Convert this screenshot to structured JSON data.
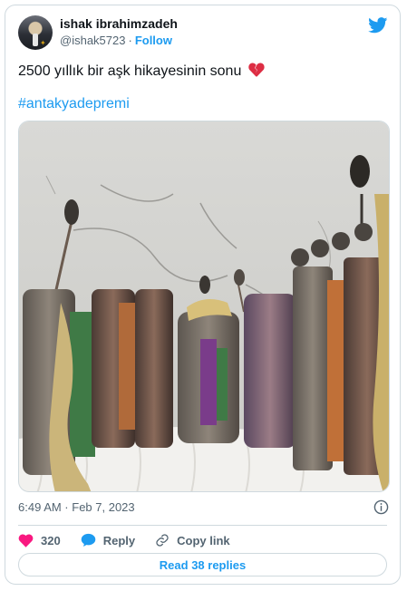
{
  "author": {
    "name": "ishak ibrahimzadeh",
    "handle": "@ishak5723",
    "separator": "·",
    "follow_label": "Follow"
  },
  "tweet": {
    "text": "2500 yıllık bir aşk hikayesinin sonu",
    "emoji": "broken-heart-icon",
    "hashtag": "#antakyadepremi"
  },
  "meta": {
    "timestamp": "6:49 AM · Feb 7, 2023"
  },
  "actions": {
    "like_count": "320",
    "reply_label": "Reply",
    "copy_label": "Copy link"
  },
  "read_replies_label": "Read 38 replies",
  "colors": {
    "accent": "#1d9bf0",
    "like": "#f91880",
    "text": "#0f1419",
    "muted": "#536471",
    "border": "#cfd9de"
  },
  "icons": {
    "logo": "twitter-bird-icon",
    "info": "info-icon",
    "like": "heart-icon",
    "reply": "speech-bubble-icon",
    "copy": "link-icon"
  }
}
